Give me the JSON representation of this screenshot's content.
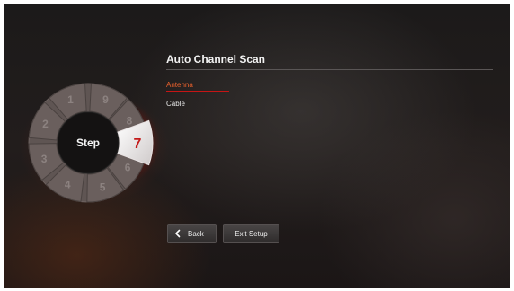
{
  "wizard": {
    "center_label": "Step",
    "current_step": "7",
    "steps": [
      "1",
      "2",
      "3",
      "4",
      "5",
      "6",
      "8",
      "9"
    ]
  },
  "page": {
    "title": "Auto Channel Scan"
  },
  "options": {
    "items": [
      "Antenna",
      "Cable"
    ],
    "selected": "Antenna"
  },
  "buttons": {
    "back_label": "Back",
    "exit_label": "Exit Setup"
  },
  "icons": {
    "back": "chevron-left-icon"
  },
  "colors": {
    "accent": "#e8602c",
    "highlight_red": "#c61515",
    "step_number": "#c41a1a"
  }
}
